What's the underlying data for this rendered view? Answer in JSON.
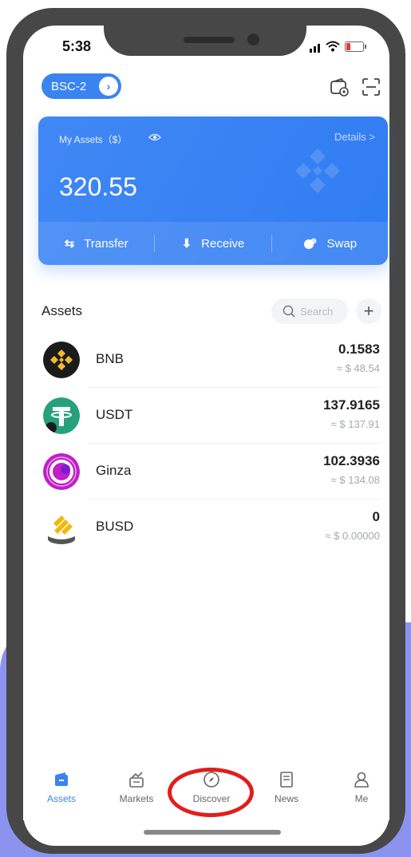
{
  "status_bar": {
    "time": "5:38"
  },
  "header": {
    "network_label": "BSC-2"
  },
  "card": {
    "label": "My Assets（$）",
    "details": "Details  >",
    "total_value": "320.55",
    "actions": [
      "Transfer",
      "Receive",
      "Swap"
    ]
  },
  "assets": {
    "title": "Assets",
    "search_placeholder": "Search",
    "add_symbol": "+",
    "items": [
      {
        "name": "BNB",
        "amount": "0.1583",
        "usd": "≈ $ 48.54"
      },
      {
        "name": "USDT",
        "amount": "137.9165",
        "usd": "≈ $ 137.91"
      },
      {
        "name": "Ginza",
        "amount": "102.3936",
        "usd": "≈ $ 134.08"
      },
      {
        "name": "BUSD",
        "amount": "0",
        "usd": "≈ $ 0.00000"
      }
    ]
  },
  "tabs": [
    {
      "label": "Assets",
      "icon": "wallet-icon",
      "active": true
    },
    {
      "label": "Markets",
      "icon": "chart-icon"
    },
    {
      "label": "Discover",
      "icon": "compass-icon"
    },
    {
      "label": "News",
      "icon": "news-icon"
    },
    {
      "label": "Me",
      "icon": "user-icon"
    }
  ],
  "colors": {
    "accent": "#3a84f2",
    "frame": "#474747",
    "highlight": "#e21d1d",
    "background_blob": "#8c93ef"
  }
}
